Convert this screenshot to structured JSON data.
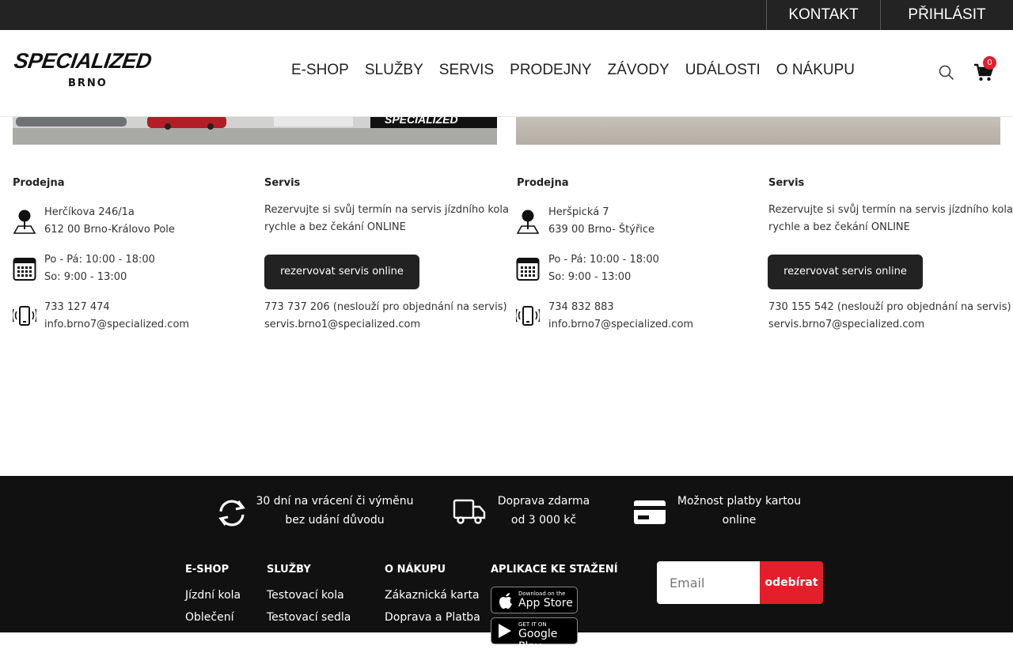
{
  "topbar": {
    "contact": "KONTAKT",
    "login": "PŘIHLÁSIT"
  },
  "logo": {
    "brand": "SPECIALIZED",
    "city": "BRNO"
  },
  "nav": [
    "E-SHOP",
    "SLUŽBY",
    "SERVIS",
    "PRODEJNY",
    "ZÁVODY",
    "UDÁLOSTI",
    "O NÁKUPU"
  ],
  "cart": {
    "count": "0"
  },
  "stores": [
    {
      "shop_title": "Prodejna",
      "address1": "Herčíkova 246/1a",
      "address2": "612 00 Brno-Královo Pole",
      "hours1": "Po - Pá: 10:00 - 18:00",
      "hours2": "So: 9:00 - 13:00",
      "phone": "733 127 474",
      "email": "info.brno7@specialized.com",
      "service_title": "Servis",
      "service_text1": "Rezervujte si svůj termín na servis jízdního kola",
      "service_text2": "rychle a bez čekání ONLINE",
      "service_button": "rezervovat servis online",
      "service_phone": "773 737 206 (neslouží pro objednání na servis)",
      "service_email": "servis.brno1@specialized.com"
    },
    {
      "shop_title": "Prodejna",
      "address1": "Heršpická 7",
      "address2": "639 00 Brno- Štýřice",
      "hours1": "Po - Pá: 10:00 - 18:00",
      "hours2": "So: 9:00 - 13:00",
      "phone": "734 832 883",
      "email": "info.brno7@specialized.com",
      "service_title": "Servis",
      "service_text1": "Rezervujte si svůj termín na servis jízdního kola",
      "service_text2": "rychle a bez čekání ONLINE",
      "service_button": "rezervovat servis online",
      "service_phone": "730 155 542 (neslouží pro objednání na servis)",
      "service_email": "servis.brno7@specialized.com"
    }
  ],
  "features": [
    {
      "line1": "30 dní na vrácení či výměnu",
      "line2": "bez udání důvodu",
      "icon": "refresh-icon"
    },
    {
      "line1": "Doprava zdarma",
      "line2": "od 3 000 kč",
      "icon": "truck-icon"
    },
    {
      "line1": "Možnost platby kartou",
      "line2": "online",
      "icon": "card-icon"
    }
  ],
  "footer_cols": {
    "eshop": {
      "title": "E-SHOP",
      "links": [
        "Jízdní kola",
        "Oblečení"
      ]
    },
    "services": {
      "title": "SLUŽBY",
      "links": [
        "Testovací kola",
        "Testovací sedla"
      ]
    },
    "purchase": {
      "title": "O NÁKUPU",
      "links": [
        "Zákaznická karta",
        "Doprava a Platba"
      ]
    },
    "apps": {
      "title": "APLIKACE KE STAŽENÍ",
      "appstore_small": "Download on the",
      "appstore_big": "App Store",
      "gplay_small": "GET IT ON",
      "gplay_big": "Google Play"
    }
  },
  "newsletter": {
    "placeholder": "Email",
    "button": "odebírat"
  },
  "colors": {
    "accent": "#e41e2b",
    "dark": "#222222",
    "footer": "#111111"
  }
}
